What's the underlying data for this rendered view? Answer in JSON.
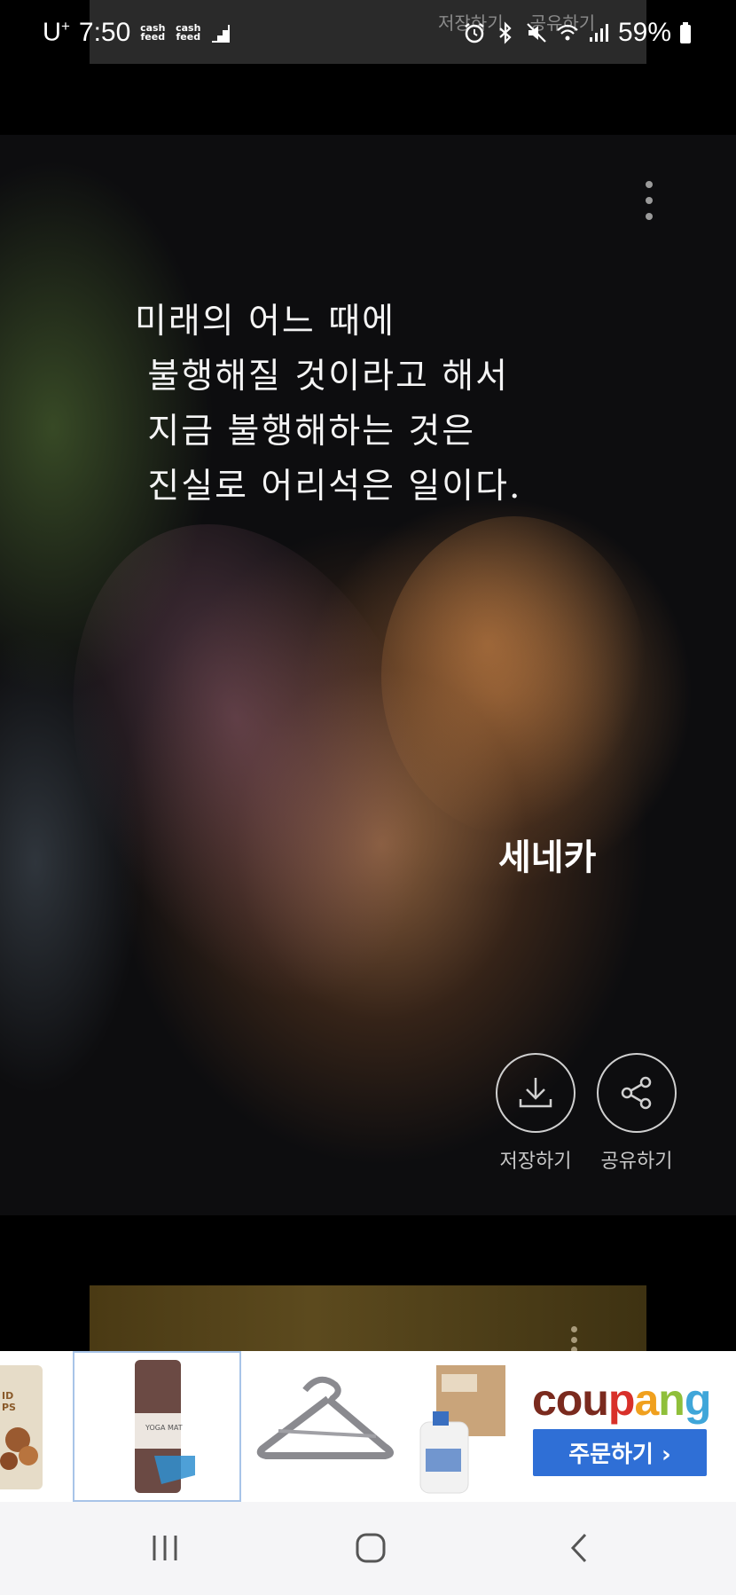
{
  "status_bar": {
    "carrier": "U",
    "carrier_sup": "+",
    "time": "7:50",
    "cashfeed_1": "cash feed",
    "cashfeed_2": "cash feed",
    "battery": "59%"
  },
  "ghost_card": {
    "save_label": "저장하기",
    "share_label": "공유하기"
  },
  "quote_card": {
    "lines": [
      "미래의 어느 때에",
      " 불행해질 것이라고 해서",
      " 지금 불행해하는 것은",
      " 진실로 어리석은 일이다."
    ],
    "author": "세네카",
    "save_label": "저장하기",
    "share_label": "공유하기"
  },
  "ad": {
    "brand": [
      "cou",
      "p",
      "a",
      "n",
      "g"
    ],
    "brand_colors": [
      "#7a2a1e",
      "#d8302a",
      "#f0a01e",
      "#8fbf3a",
      "#3fa6d9"
    ],
    "order_label": "주문하기 ›",
    "product_yoga_text": "YOGA MAT",
    "product_nuts_text": "ID PS"
  },
  "colors": {
    "accent_blue": "#2f6fd6",
    "card_bg": "#0d0d0f"
  }
}
